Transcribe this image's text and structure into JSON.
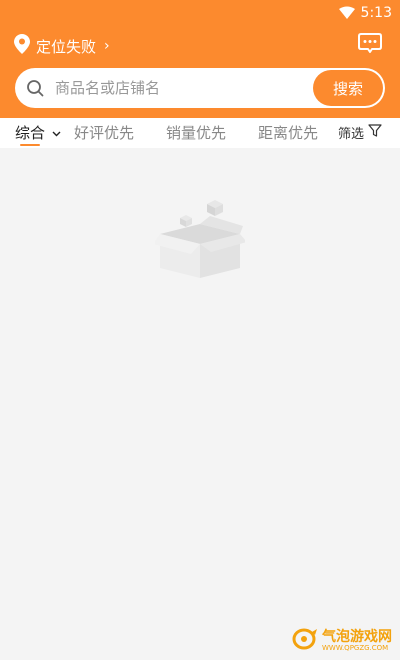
{
  "status": {
    "time": "5:13"
  },
  "location": {
    "label": "定位失败",
    "chevron": "›"
  },
  "search": {
    "placeholder": "商品名或店铺名",
    "button_label": "搜索"
  },
  "tabs": [
    {
      "label": "综合",
      "active": true
    },
    {
      "label": "好评优先",
      "active": false
    },
    {
      "label": "销量优先",
      "active": false
    },
    {
      "label": "距离优先",
      "active": false
    }
  ],
  "filter": {
    "label": "筛选"
  },
  "watermark": {
    "main": "气泡游戏网",
    "sub": "WWW.QPGZG.COM"
  },
  "colors": {
    "accent": "#fc8a2e",
    "background": "#f4f4f4"
  },
  "icons": {
    "wifi": "wifi-icon",
    "location": "location-pin-icon",
    "message": "message-icon",
    "search": "search-icon",
    "tab_dropdown": "chevron-down-icon",
    "filter": "filter-funnel-icon",
    "empty": "empty-box-icon"
  }
}
